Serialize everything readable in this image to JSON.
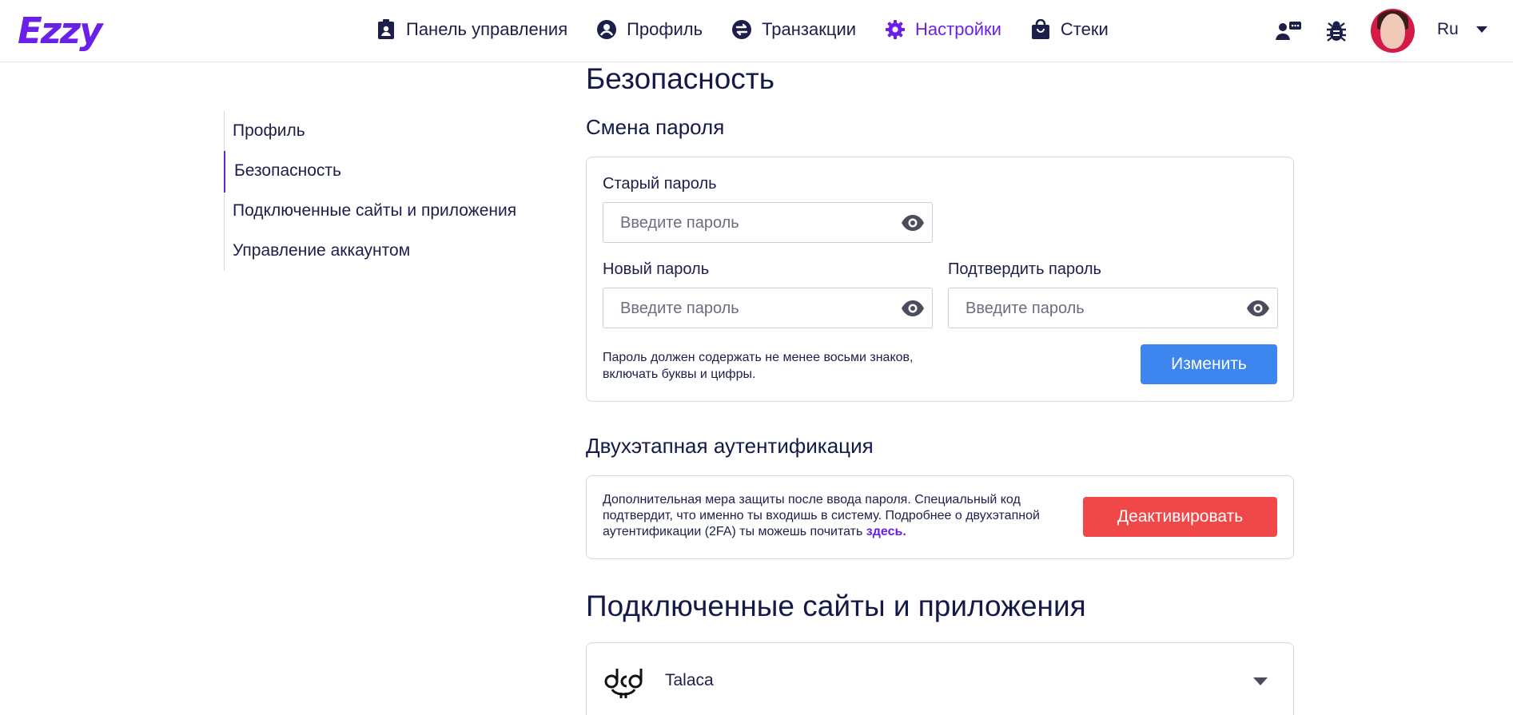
{
  "header": {
    "logo": "Ezzy",
    "nav": [
      {
        "label": "Панель управления",
        "icon": "clipboard-icon"
      },
      {
        "label": "Профиль",
        "icon": "user-circle-icon"
      },
      {
        "label": "Транзакции",
        "icon": "exchange-icon"
      },
      {
        "label": "Настройки",
        "icon": "gear-icon",
        "active": true
      },
      {
        "label": "Стеки",
        "icon": "bag-icon"
      }
    ],
    "language": "Ru"
  },
  "sidebar": {
    "items": [
      {
        "label": "Профиль"
      },
      {
        "label": "Безопасность",
        "active": true
      },
      {
        "label": "Подключенные сайты и приложения"
      },
      {
        "label": "Управление аккаунтом"
      }
    ]
  },
  "security": {
    "title": "Безопасность",
    "password_section": {
      "title": "Смена пароля",
      "old_password": {
        "label": "Старый пароль",
        "placeholder": "Введите пароль"
      },
      "new_password": {
        "label": "Новый пароль",
        "placeholder": "Введите пароль"
      },
      "confirm_password": {
        "label": "Подтвердить пароль",
        "placeholder": "Введите пароль"
      },
      "hint": "Пароль должен содержать не менее восьми знаков, включать буквы и цифры.",
      "submit_label": "Изменить"
    },
    "twofa_section": {
      "title": "Двухэтапная аутентификация",
      "description": "Дополнительная мера защиты после ввода пароля. Специальный код подтвердит, что именно ты входишь в систему. Подробнее о двухэтапной аутентификации (2FA) ты можешь почитать",
      "link_label": "здесь.",
      "button_label": "Деактивировать"
    }
  },
  "connected": {
    "title": "Подключенные сайты и приложения",
    "apps": [
      {
        "name": "Talaca"
      }
    ]
  },
  "colors": {
    "accent": "#6a20e6",
    "primary_button": "#3e86ef",
    "danger_button": "#f04848",
    "text": "#1b1f4a"
  }
}
